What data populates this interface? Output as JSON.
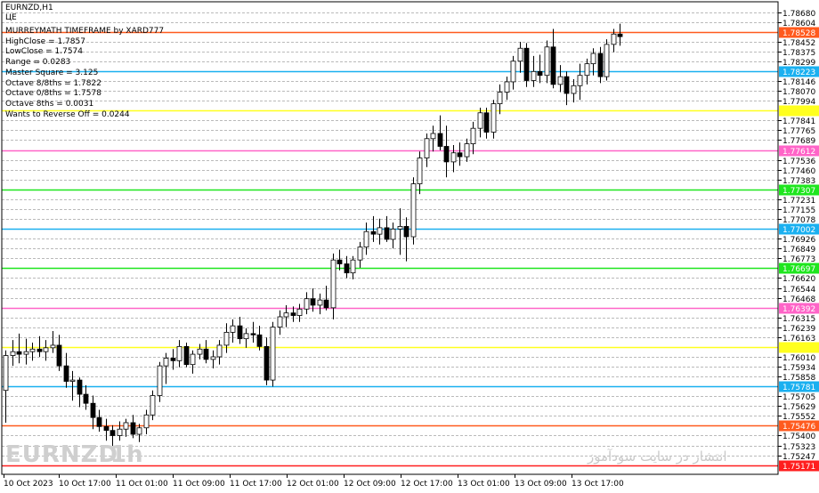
{
  "window": {
    "symbol_title": "EURNZD,H1",
    "indicator_tag": "ЦЕ"
  },
  "info_panel": [
    "MURREYMATH TIMEFRAME by XARD777",
    "HighClose = 1.7857",
    "LowClose = 1.7574",
    "Range = 0.0283",
    "Master Square = 3.125",
    "Octave 8/8ths = 1.7822",
    "Octave 0/8ths = 1.7578",
    "Octave 8ths = 0.0031",
    "Wants to Reverse Off = 0.0244"
  ],
  "watermark": {
    "symbol": "EURNZD",
    "timeframe": "1h",
    "site": "انتشار در سایت سودآموز"
  },
  "colors": {
    "background": "#ffffff",
    "text": "#000000",
    "grid": "#777777",
    "candle_bull": "#ffffff",
    "candle_bear": "#000000",
    "candle_border": "#000000",
    "axis_border": "#000000"
  },
  "chart_data": {
    "type": "candlestick",
    "symbol": "EURNZD",
    "timeframe": "H1",
    "ylim": [
      1.751,
      1.7876
    ],
    "price_ticks": [
      "1.78680",
      "1.78604",
      "1.78452",
      "1.78375",
      "1.78299",
      "1.78146",
      "1.78070",
      "1.77994",
      "1.77841",
      "1.77765",
      "1.77689",
      "1.77536",
      "1.77460",
      "1.77383",
      "1.77231",
      "1.77155",
      "1.77078",
      "1.76926",
      "1.76849",
      "1.76773",
      "1.76620",
      "1.76544",
      "1.76468",
      "1.76315",
      "1.76239",
      "1.76163",
      "1.76010",
      "1.75934",
      "1.75858",
      "1.75705",
      "1.75629",
      "1.75552",
      "1.75400",
      "1.75323",
      "1.75247"
    ],
    "time_labels": [
      "10 Oct 2023",
      "10 Oct 17:00",
      "11 Oct 01:00",
      "11 Oct 09:00",
      "11 Oct 17:00",
      "12 Oct 01:00",
      "12 Oct 09:00",
      "12 Oct 17:00",
      "13 Oct 01:00",
      "13 Oct 09:00",
      "13 Oct 17:00"
    ],
    "murrey_levels": [
      {
        "price": 1.78528,
        "label": "1.78528",
        "color": "#ff5a1e"
      },
      {
        "price": 1.78223,
        "label": "1.78223",
        "color": "#1ab0f0"
      },
      {
        "price": 1.77918,
        "label": "",
        "color": "#ffff1e"
      },
      {
        "price": 1.77612,
        "label": "1.77612",
        "color": "#ff64c8"
      },
      {
        "price": 1.77307,
        "label": "1.77307",
        "color": "#1ee61e"
      },
      {
        "price": 1.77002,
        "label": "1.77002",
        "color": "#1ab0f0"
      },
      {
        "price": 1.76697,
        "label": "1.76697",
        "color": "#1ee61e"
      },
      {
        "price": 1.76392,
        "label": "1.76392",
        "color": "#ff64c8"
      },
      {
        "price": 1.76087,
        "label": "",
        "color": "#ffff1e"
      },
      {
        "price": 1.75781,
        "label": "1.75781",
        "color": "#1ab0f0"
      },
      {
        "price": 1.75476,
        "label": "1.75476",
        "color": "#ff5a1e"
      },
      {
        "price": 1.75171,
        "label": "1.75171",
        "color": "#ff1e1e"
      }
    ],
    "candles": [
      [
        1.7575,
        1.7606,
        1.755,
        1.7602
      ],
      [
        1.7602,
        1.7614,
        1.7594,
        1.7605
      ],
      [
        1.7605,
        1.7619,
        1.7596,
        1.7603
      ],
      [
        1.7603,
        1.7615,
        1.7595,
        1.7605
      ],
      [
        1.7605,
        1.7612,
        1.7598,
        1.7607
      ],
      [
        1.7607,
        1.7617,
        1.7601,
        1.7605
      ],
      [
        1.7605,
        1.7614,
        1.7598,
        1.7608
      ],
      [
        1.7608,
        1.7621,
        1.7604,
        1.761
      ],
      [
        1.761,
        1.7618,
        1.759,
        1.7594
      ],
      [
        1.7594,
        1.7604,
        1.7577,
        1.7582
      ],
      [
        1.7582,
        1.759,
        1.7567,
        1.7583
      ],
      [
        1.7583,
        1.7585,
        1.7562,
        1.7572
      ],
      [
        1.7572,
        1.7579,
        1.756,
        1.7565
      ],
      [
        1.7565,
        1.7571,
        1.7545,
        1.7554
      ],
      [
        1.7554,
        1.756,
        1.7543,
        1.7547
      ],
      [
        1.7547,
        1.7553,
        1.7536,
        1.7544
      ],
      [
        1.7544,
        1.7548,
        1.7532,
        1.754
      ],
      [
        1.754,
        1.7551,
        1.7536,
        1.7545
      ],
      [
        1.7545,
        1.7553,
        1.7539,
        1.755
      ],
      [
        1.755,
        1.7556,
        1.7538,
        1.7541
      ],
      [
        1.7541,
        1.7549,
        1.7535,
        1.7546
      ],
      [
        1.7546,
        1.756,
        1.7541,
        1.7556
      ],
      [
        1.7556,
        1.7575,
        1.7552,
        1.7571
      ],
      [
        1.7571,
        1.7597,
        1.7566,
        1.7594
      ],
      [
        1.7594,
        1.7604,
        1.758,
        1.76
      ],
      [
        1.76,
        1.7607,
        1.7591,
        1.7598
      ],
      [
        1.7598,
        1.7614,
        1.7593,
        1.7609
      ],
      [
        1.7609,
        1.7612,
        1.7593,
        1.7595
      ],
      [
        1.7595,
        1.7606,
        1.7588,
        1.7603
      ],
      [
        1.7603,
        1.7611,
        1.7599,
        1.7607
      ],
      [
        1.7607,
        1.7614,
        1.7596,
        1.7599
      ],
      [
        1.7599,
        1.7606,
        1.7592,
        1.7601
      ],
      [
        1.7601,
        1.7614,
        1.7595,
        1.761
      ],
      [
        1.761,
        1.7627,
        1.7604,
        1.762
      ],
      [
        1.762,
        1.763,
        1.7612,
        1.7625
      ],
      [
        1.7625,
        1.7632,
        1.7611,
        1.7615
      ],
      [
        1.7615,
        1.7623,
        1.7608,
        1.7619
      ],
      [
        1.7619,
        1.7628,
        1.7612,
        1.7618
      ],
      [
        1.7618,
        1.7625,
        1.7606,
        1.7609
      ],
      [
        1.7609,
        1.7616,
        1.7579,
        1.7583
      ],
      [
        1.7583,
        1.7628,
        1.7578,
        1.7624
      ],
      [
        1.7624,
        1.7637,
        1.7618,
        1.7632
      ],
      [
        1.7632,
        1.7641,
        1.7624,
        1.7635
      ],
      [
        1.7635,
        1.764,
        1.7628,
        1.7633
      ],
      [
        1.7633,
        1.7642,
        1.7628,
        1.7638
      ],
      [
        1.7638,
        1.7651,
        1.7634,
        1.7646
      ],
      [
        1.7646,
        1.7654,
        1.7636,
        1.7641
      ],
      [
        1.7641,
        1.765,
        1.7634,
        1.7645
      ],
      [
        1.7645,
        1.7656,
        1.7637,
        1.7639
      ],
      [
        1.7639,
        1.7681,
        1.763,
        1.7676
      ],
      [
        1.7676,
        1.7684,
        1.7668,
        1.7673
      ],
      [
        1.7673,
        1.7679,
        1.7662,
        1.7666
      ],
      [
        1.7666,
        1.7679,
        1.7661,
        1.7676
      ],
      [
        1.7676,
        1.769,
        1.767,
        1.7686
      ],
      [
        1.7686,
        1.7705,
        1.768,
        1.7698
      ],
      [
        1.7698,
        1.771,
        1.769,
        1.7696
      ],
      [
        1.7696,
        1.7708,
        1.7688,
        1.7701
      ],
      [
        1.7701,
        1.771,
        1.769,
        1.7692
      ],
      [
        1.7692,
        1.7705,
        1.7685,
        1.77
      ],
      [
        1.77,
        1.7716,
        1.768,
        1.7702
      ],
      [
        1.7702,
        1.7709,
        1.7675,
        1.7694
      ],
      [
        1.7694,
        1.774,
        1.7688,
        1.7735
      ],
      [
        1.7735,
        1.776,
        1.7727,
        1.7755
      ],
      [
        1.7755,
        1.7774,
        1.7748,
        1.777
      ],
      [
        1.777,
        1.778,
        1.776,
        1.7774
      ],
      [
        1.7774,
        1.7788,
        1.7761,
        1.7764
      ],
      [
        1.7764,
        1.778,
        1.774,
        1.7752
      ],
      [
        1.7752,
        1.7765,
        1.7744,
        1.7759
      ],
      [
        1.7759,
        1.7767,
        1.7749,
        1.7756
      ],
      [
        1.7756,
        1.777,
        1.7752,
        1.7766
      ],
      [
        1.7766,
        1.7783,
        1.7758,
        1.7778
      ],
      [
        1.7778,
        1.7794,
        1.7771,
        1.779
      ],
      [
        1.779,
        1.7794,
        1.777,
        1.7775
      ],
      [
        1.7775,
        1.78,
        1.777,
        1.7797
      ],
      [
        1.7797,
        1.7812,
        1.7789,
        1.7806
      ],
      [
        1.7806,
        1.7818,
        1.78,
        1.7814
      ],
      [
        1.7814,
        1.7834,
        1.7808,
        1.783
      ],
      [
        1.783,
        1.7845,
        1.7821,
        1.784
      ],
      [
        1.784,
        1.7844,
        1.781,
        1.7815
      ],
      [
        1.7815,
        1.7834,
        1.781,
        1.7822
      ],
      [
        1.7822,
        1.7835,
        1.7813,
        1.7819
      ],
      [
        1.7819,
        1.7846,
        1.7813,
        1.7841
      ],
      [
        1.7841,
        1.7855,
        1.7809,
        1.7812
      ],
      [
        1.7812,
        1.7827,
        1.7806,
        1.7818
      ],
      [
        1.7818,
        1.7822,
        1.7796,
        1.7805
      ],
      [
        1.7805,
        1.7816,
        1.7798,
        1.7811
      ],
      [
        1.7811,
        1.7828,
        1.78,
        1.7819
      ],
      [
        1.7819,
        1.7832,
        1.7812,
        1.7828
      ],
      [
        1.7828,
        1.784,
        1.7819,
        1.7836
      ],
      [
        1.7836,
        1.7841,
        1.7813,
        1.7818
      ],
      [
        1.7818,
        1.7847,
        1.7815,
        1.7843
      ],
      [
        1.7843,
        1.7855,
        1.7837,
        1.7851
      ],
      [
        1.7851,
        1.7859,
        1.7842,
        1.7849
      ]
    ]
  }
}
